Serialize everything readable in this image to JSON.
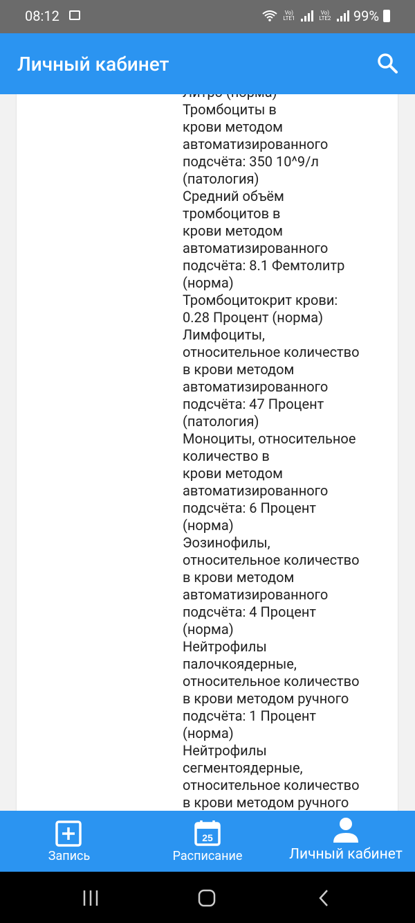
{
  "status": {
    "time": "08:12",
    "battery": "99%",
    "sim1": "Vo) LTE1",
    "sim2": "Vo) LTE2"
  },
  "header": {
    "title": "Личный кабинет",
    "search_icon": "search-icon"
  },
  "results_text": "Литро (норма)\nТромбоциты в\nкрови методом\nавтоматизированного\nподсчёта: 350 10^9/л\n(патология)\nСредний объём\nтромбоцитов в\nкрови методом\nавтоматизированного\nподсчёта: 8.1 Фемтолитр\n(норма)\nТромбоцитокрит крови:\n0.28 Процент (норма)\nЛимфоциты,\nотносительное количество\nв крови методом\nавтоматизированного\nподсчёта: 47 Процент\n(патология)\nМоноциты, относительное\nколичество в\nкрови методом\nавтоматизированного\nподсчёта: 6 Процент\n(норма)\nЭозинофилы,\nотносительное количество\nв крови методом\nавтоматизированного\nподсчёта: 4 Процент\n(норма)\nНейтрофилы\nпалочкоядерные,\nотносительное количество\nв крови методом ручного\nподсчёта: 1 Процент\n(норма)\nНейтрофилы\nсегментоядерные,\nотносительное количество\nв крови методом ручного",
  "bottom_nav": {
    "items": [
      {
        "label": "Запись",
        "icon": "add-box-icon"
      },
      {
        "label": "Расписание",
        "icon": "calendar-icon",
        "calendar_day": "25"
      },
      {
        "label": "Личный кабинет",
        "icon": "person-icon"
      }
    ]
  },
  "colors": {
    "primary": "#2b94f1",
    "status_bar": "#6b6b6b"
  }
}
